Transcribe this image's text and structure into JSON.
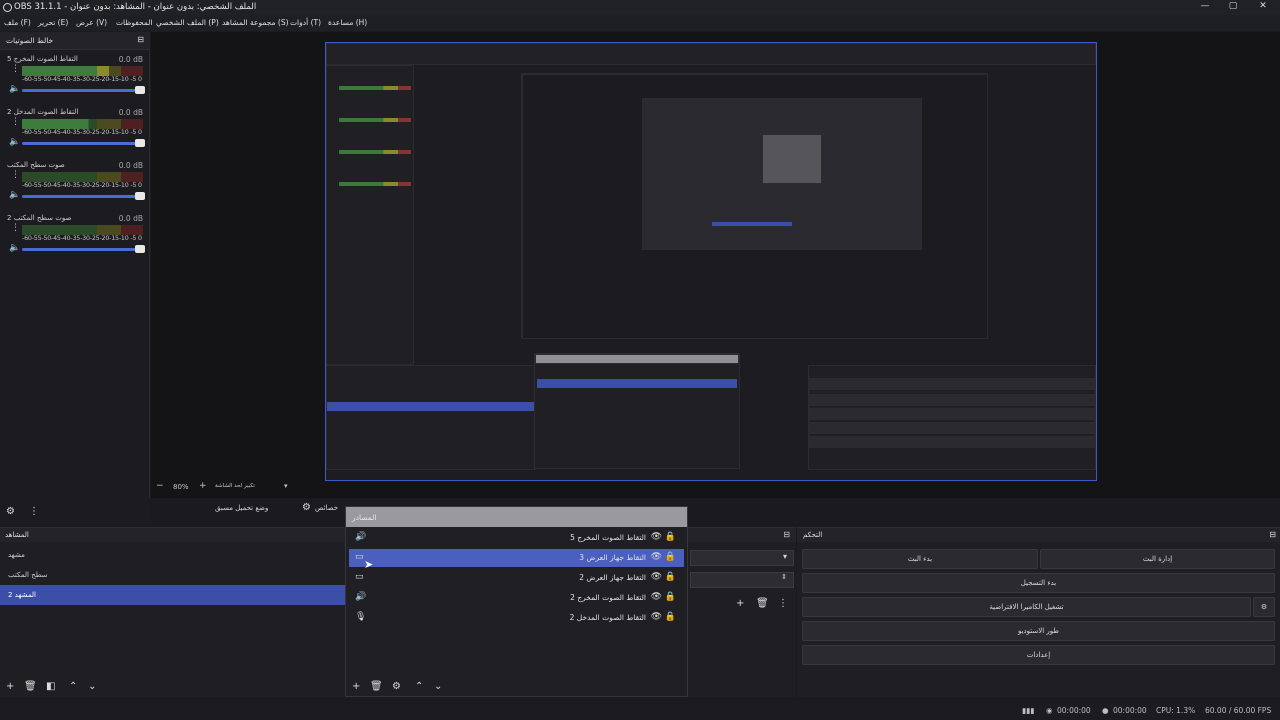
{
  "window": {
    "title": "OBS 31.1.1 - الملف الشخصي: بدون عنوان - المشاهد: بدون عنوان",
    "min": "—",
    "max": "▢",
    "close": "✕"
  },
  "menu": [
    "ملف (F)",
    "تحرير (E)",
    "عرض (V)",
    "المحفوظات",
    "الملف الشخصي (P)",
    "مجموعة المشاهد (S)",
    "أدوات (T)",
    "مساعدة (H)"
  ],
  "mixer": {
    "title": "خالط الصوتيات",
    "ticks": "-60-55-50-45-40-35-30-25-20-15-10 -5  0",
    "channels": [
      {
        "name": "التقاط الصوت المخرج 5",
        "db": "0.0 dB",
        "level": 0.72
      },
      {
        "name": "التقاط الصوت المدخل 2",
        "db": "0.0 dB",
        "level": 0.55
      },
      {
        "name": "صوت سطح المكتب",
        "db": "0.0 dB",
        "level": 0.0
      },
      {
        "name": "صوت سطح المكتب 2",
        "db": "0.0 dB",
        "level": 0.0
      }
    ]
  },
  "zoom": {
    "minus": "−",
    "value": "80%",
    "plus": "+",
    "mode": "تكبير لحد الشاشة",
    "chev": "▾"
  },
  "studio": {
    "studio_mode": "وضع تحميل مسبق",
    "settings_label": "خصائص"
  },
  "scenes": {
    "title": "المشاهد",
    "items": [
      "مشهد",
      "سطح المكتب",
      "المشهد 2"
    ],
    "selected": 2
  },
  "sources": {
    "title": "المصادر",
    "items": [
      {
        "label": "التقاط الصوت المخرج 5",
        "icon": "speaker"
      },
      {
        "label": "التقاط جهاز العرض 3",
        "icon": "monitor"
      },
      {
        "label": "التقاط جهاز العرض 2",
        "icon": "monitor"
      },
      {
        "label": "التقاط الصوت المخرج 2",
        "icon": "speaker"
      },
      {
        "label": "التقاط الصوت المدخل 2",
        "icon": "mic"
      }
    ],
    "selected": 1
  },
  "controls": {
    "title": "التحكم",
    "start_stream": "إدارة البث",
    "start_broadcast": "بدء البث",
    "start_recording": "بدء التسجيل",
    "virtual_cam": "تشغيل الكاميرا الافتراضية",
    "studio_mode": "طور الاستوديو",
    "settings": "إعدادات"
  },
  "status": {
    "stream_time": "00:00:00",
    "rec_time": "00:00:00",
    "cpu": "CPU: 1.3%",
    "fps": "60.00 / 60.00 FPS"
  },
  "colors": {
    "accent": "#3b4ea8",
    "selection": "#4a5fc0",
    "bg": "#1b1b1f"
  }
}
